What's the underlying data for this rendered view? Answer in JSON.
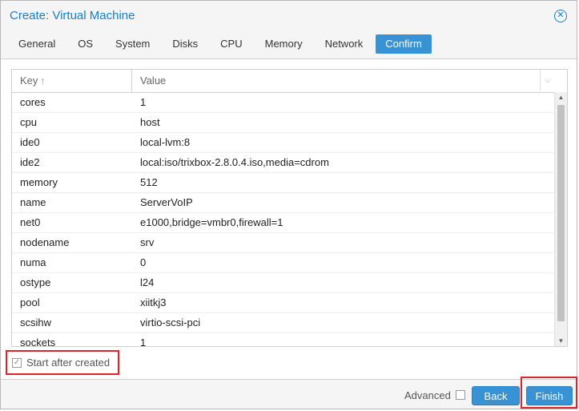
{
  "dialog": {
    "title": "Create: Virtual Machine"
  },
  "tabs": [
    {
      "label": "General"
    },
    {
      "label": "OS"
    },
    {
      "label": "System"
    },
    {
      "label": "Disks"
    },
    {
      "label": "CPU"
    },
    {
      "label": "Memory"
    },
    {
      "label": "Network"
    },
    {
      "label": "Confirm",
      "active": true
    }
  ],
  "grid": {
    "key_header": "Key",
    "value_header": "Value",
    "rows": [
      {
        "key": "cores",
        "value": "1"
      },
      {
        "key": "cpu",
        "value": "host"
      },
      {
        "key": "ide0",
        "value": "local-lvm:8"
      },
      {
        "key": "ide2",
        "value": "local:iso/trixbox-2.8.0.4.iso,media=cdrom"
      },
      {
        "key": "memory",
        "value": "512"
      },
      {
        "key": "name",
        "value": "ServerVoIP"
      },
      {
        "key": "net0",
        "value": "e1000,bridge=vmbr0,firewall=1"
      },
      {
        "key": "nodename",
        "value": "srv"
      },
      {
        "key": "numa",
        "value": "0"
      },
      {
        "key": "ostype",
        "value": "l24"
      },
      {
        "key": "pool",
        "value": "xiitkj3"
      },
      {
        "key": "scsihw",
        "value": "virtio-scsi-pci"
      },
      {
        "key": "sockets",
        "value": "1"
      }
    ]
  },
  "start_after_created": {
    "label": "Start after created",
    "checked": true
  },
  "footer": {
    "advanced_label": "Advanced",
    "advanced_checked": false,
    "back_label": "Back",
    "finish_label": "Finish"
  },
  "colors": {
    "accent": "#3892d4",
    "title": "#157fcc",
    "highlight": "#d9262b"
  }
}
